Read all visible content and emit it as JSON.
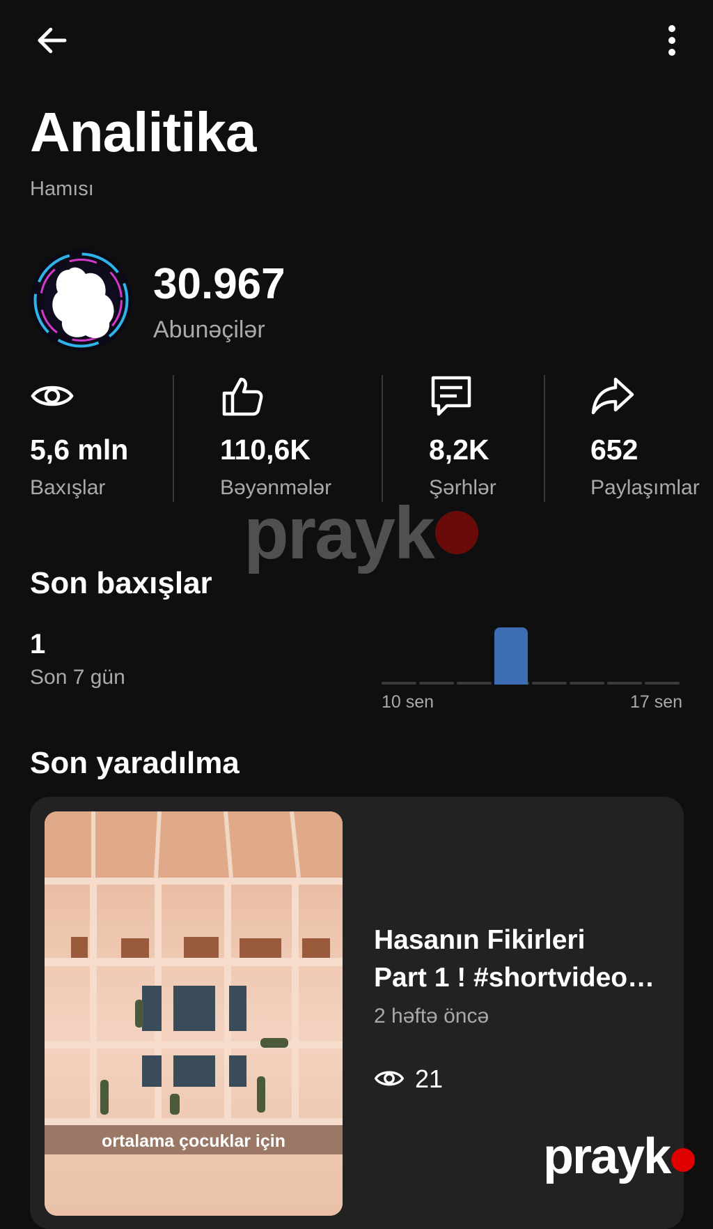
{
  "header": {
    "back_icon": "arrow-left-icon",
    "more_icon": "more-vertical-icon",
    "title": "Analitika",
    "subtitle": "Hamısı"
  },
  "channel": {
    "subscriber_count": "30.967",
    "subscriber_label": "Abunəçilər"
  },
  "stats": [
    {
      "icon": "eye-icon",
      "value": "5,6 mln",
      "label": "Baxışlar"
    },
    {
      "icon": "thumbs-up-icon",
      "value": "110,6K",
      "label": "Bəyənmələr"
    },
    {
      "icon": "comment-icon",
      "value": "8,2K",
      "label": "Şərhlər"
    },
    {
      "icon": "share-icon",
      "value": "652",
      "label": "Paylaşımlar"
    }
  ],
  "watermark": {
    "text": "prayk"
  },
  "recent_views": {
    "title": "Son baxışlar",
    "value": "1",
    "period_label": "Son 7 gün",
    "accent_color": "#3d6eb4"
  },
  "chart_data": {
    "type": "bar",
    "categories": [
      "10 sen",
      "",
      "",
      "",
      "",
      "",
      "",
      "17 sen"
    ],
    "values": [
      0,
      0,
      0,
      1,
      0,
      0,
      0,
      0
    ],
    "tick_labels": [
      "10 sen",
      "17 sen"
    ],
    "ylim": [
      0,
      1
    ],
    "grid": false
  },
  "recent_creation": {
    "title": "Son yaradılma",
    "video": {
      "title_line1": "Hasanın Fikirleri",
      "title_line2": "Part 1 ! #shortvideo…",
      "thumbnail_caption": "ortalama çocuklar için",
      "time_ago": "2 həftə öncə",
      "views": "21",
      "views_icon": "eye-icon"
    }
  }
}
